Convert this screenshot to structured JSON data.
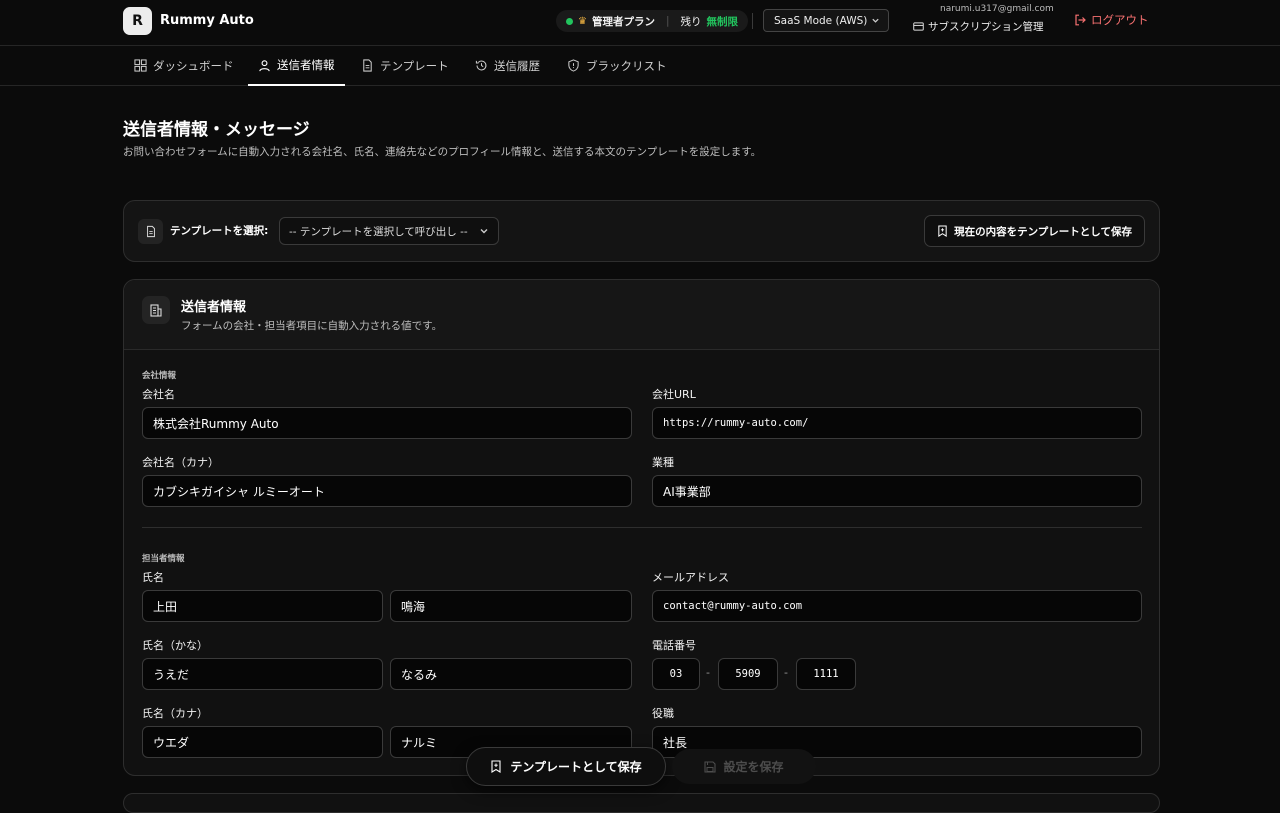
{
  "app": {
    "logo_letter": "R",
    "name": "Rummy Auto"
  },
  "topbar": {
    "plan_label": "管理者プラン",
    "remaining_label": "残り",
    "remaining_value": "無制限",
    "mode_select": "SaaS Mode (AWS)",
    "user_email": "narumi.u317@gmail.com",
    "subscription_link": "サブスクリプション管理",
    "logout": "ログアウト",
    "status_color": "#22c55e"
  },
  "nav": {
    "items": [
      {
        "label": "ダッシュボード",
        "icon": "grid-icon"
      },
      {
        "label": "送信者情報",
        "icon": "user-icon",
        "active": true
      },
      {
        "label": "テンプレート",
        "icon": "document-icon"
      },
      {
        "label": "送信履歴",
        "icon": "history-icon"
      },
      {
        "label": "ブラックリスト",
        "icon": "shield-icon"
      }
    ]
  },
  "page": {
    "title": "送信者情報・メッセージ",
    "description": "お問い合わせフォームに自動入力される会社名、氏名、連絡先などのプロフィール情報と、送信する本文のテンプレートを設定します。"
  },
  "template_bar": {
    "label": "テンプレートを選択:",
    "select_placeholder": "-- テンプレートを選択して呼び出し --",
    "save_button": "現在の内容をテンプレートとして保存"
  },
  "sender": {
    "title": "送信者情報",
    "description": "フォームの会社・担当者項目に自動入力される値です。",
    "company_section": "会社情報",
    "person_section": "担当者情報",
    "fields": {
      "company_name": {
        "label": "会社名",
        "value": "株式会社Rummy Auto"
      },
      "company_url": {
        "label": "会社URL",
        "value": "https://rummy-auto.com/"
      },
      "company_kana": {
        "label": "会社名（カナ）",
        "value": "カブシキガイシャ ルミーオート"
      },
      "industry": {
        "label": "業種",
        "value": "AI事業部"
      },
      "name": {
        "label": "氏名",
        "last": "上田",
        "first": "鳴海"
      },
      "email": {
        "label": "メールアドレス",
        "value": "contact@rummy-auto.com"
      },
      "name_hiragana": {
        "label": "氏名（かな）",
        "last": "うえだ",
        "first": "なるみ"
      },
      "phone": {
        "label": "電話番号",
        "part1": "03",
        "part2": "5909",
        "part3": "1111",
        "separator": "-"
      },
      "name_katakana": {
        "label": "氏名（カナ）",
        "last": "ウエダ",
        "first": "ナルミ"
      },
      "position": {
        "label": "役職",
        "value": "社長"
      }
    }
  },
  "floating": {
    "save_as_template": "テンプレートとして保存",
    "save_settings": "設定を保存"
  }
}
